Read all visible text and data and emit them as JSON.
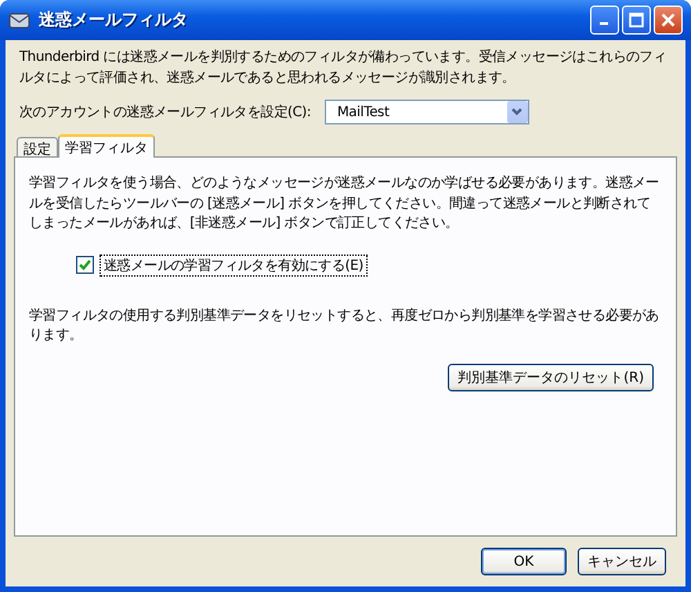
{
  "window": {
    "title": "迷惑メールフィルタ"
  },
  "intro": "Thunderbird には迷惑メールを判別するためのフィルタが備わっています。受信メッセージはこれらのフィルタによって評価され、迷惑メールであると思われるメッセージが識別されます。",
  "account": {
    "label": "次のアカウントの迷惑メールフィルタを設定(C):",
    "value": "MailTest"
  },
  "tabs": [
    {
      "label": "設定",
      "selected": false
    },
    {
      "label": "学習フィルタ",
      "selected": true
    }
  ],
  "panel": {
    "description": "学習フィルタを使う場合、どのようなメッセージが迷惑メールなのか学ばせる必要があります。迷惑メールを受信したらツールバーの [迷惑メール] ボタンを押してください。間違って迷惑メールと判断されてしまったメールがあれば、[非迷惑メール] ボタンで訂正してください。",
    "checkbox": {
      "label": "迷惑メールの学習フィルタを有効にする(E)",
      "checked": true
    },
    "reset_note": "学習フィルタの使用する判別基準データをリセットすると、再度ゼロから判別基準を学習させる必要があります。",
    "reset_button": "判別基準データのリセット(R)"
  },
  "buttons": [
    "OK",
    "キャンセル"
  ]
}
